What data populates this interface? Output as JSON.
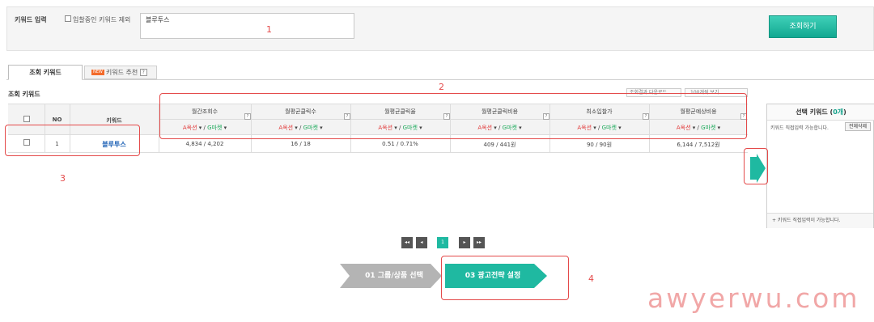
{
  "search": {
    "keyword_label": "키워드 입력",
    "exclude_label": "입찰중인 키워드 제외",
    "keyword_value": "블루투스",
    "submit_label": "조회하기"
  },
  "tabs": [
    {
      "label": "조회 키워드"
    },
    {
      "label": "키워드 추천",
      "badge": "NEW",
      "help": "?"
    }
  ],
  "section_title": "조회 키워드",
  "tools": {
    "download_label": "조회결과 다운로드",
    "per_page_label": "100개씩 보기"
  },
  "table": {
    "headers": {
      "no": "NO",
      "keyword": "키워드",
      "metrics": [
        "월간조회수",
        "월평균클릭수",
        "월평균클릭율",
        "월평균클릭비용",
        "최소입찰가",
        "월평균예상비용"
      ]
    },
    "help_mark": "?",
    "sub_a": "A옥션",
    "sub_sep": " ▾ / ",
    "sub_g": "G마켓",
    "sub_tail": " ▾",
    "rows": [
      {
        "no": "1",
        "keyword": "블루투스",
        "values": [
          "4,834 / 4,202",
          "16 / 18",
          "0.51 / 0.71%",
          "409 / 441원",
          "90 / 90원",
          "6,144 / 7,512원"
        ]
      }
    ]
  },
  "selected_panel": {
    "title_prefix": "선택 키워드 (",
    "count": "0개",
    "title_suffix": ")",
    "direct_input": "키워드 직접입력 가능합니다.",
    "clear_label": "전체삭제",
    "footer": "+ 키워드 직접입력이 가능합니다."
  },
  "pagination": {
    "first": "◂◂",
    "prev": "◂",
    "current": "1",
    "next": "▸",
    "last": "▸▸"
  },
  "steps": [
    {
      "label": "01 그룹/상품 선택",
      "color": "#b4b4b4"
    },
    {
      "label": "03 광고전략 설정",
      "color": "#1fb9a1"
    }
  ],
  "annotations": [
    "1",
    "2",
    "3",
    "4"
  ],
  "watermark": "awyerwu.com",
  "colors": {
    "accent": "#1fb9a1",
    "annotation": "#e44a4a"
  }
}
